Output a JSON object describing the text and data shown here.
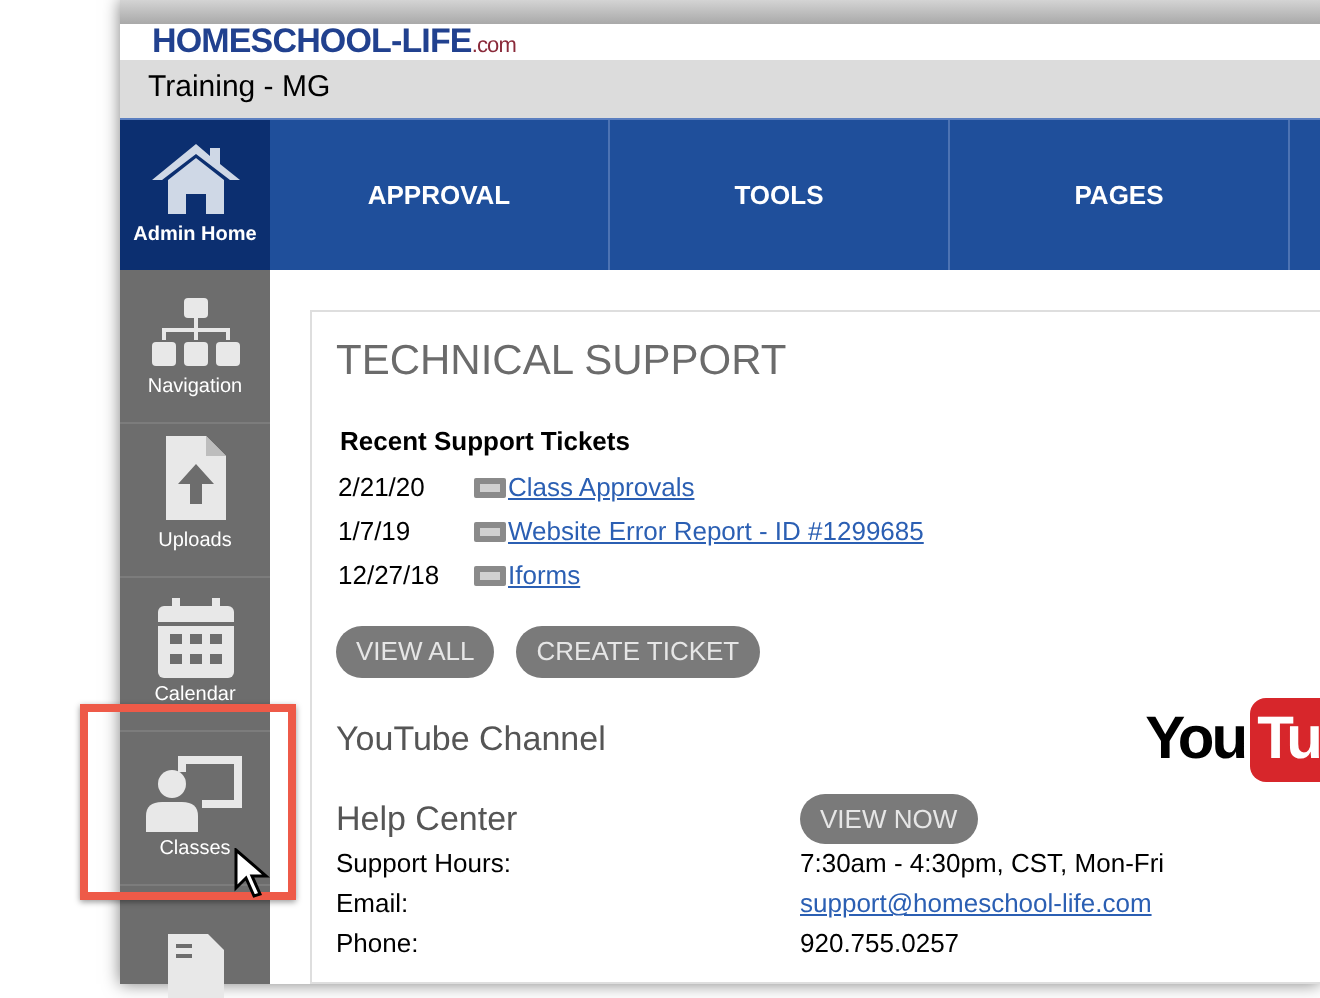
{
  "logo": {
    "name": "HOMESCHOOL-LIFE",
    "suffix": ".com"
  },
  "account": {
    "title": "Training - MG"
  },
  "nav_tabs": [
    {
      "label": "Admin Home",
      "selected": true
    },
    {
      "label": "APPROVAL",
      "selected": false
    },
    {
      "label": "TOOLS",
      "selected": false
    },
    {
      "label": "PAGES",
      "selected": false
    }
  ],
  "sidebar": {
    "items": [
      {
        "label": "Navigation",
        "highlighted": false
      },
      {
        "label": "Uploads",
        "highlighted": false
      },
      {
        "label": "Calendar",
        "highlighted": false
      },
      {
        "label": "Classes",
        "highlighted": true
      },
      {
        "highlighted": false
      }
    ]
  },
  "support": {
    "title": "TECHNICAL SUPPORT",
    "tickets_heading": "Recent Support Tickets",
    "tickets": [
      {
        "date": "2/21/20",
        "title": "Class Approvals"
      },
      {
        "date": "1/7/19",
        "title": "Website Error Report - ID #1299685"
      },
      {
        "date": "12/27/18",
        "title": "Iforms"
      }
    ],
    "buttons": [
      "VIEW ALL",
      "CREATE TICKET"
    ],
    "youtube": {
      "heading": "YouTube Channel",
      "logo_left": "You",
      "logo_right": "Tu"
    },
    "help": {
      "heading": "Help Center",
      "button": "VIEW NOW",
      "rows": [
        {
          "label": "Support Hours:",
          "value": "7:30am - 4:30pm, CST, Mon-Fri",
          "kind": "text"
        },
        {
          "label": "Email:",
          "value": "support@homeschool-life.com",
          "kind": "link"
        },
        {
          "label": "Phone:",
          "value": "920.755.0257",
          "kind": "text"
        }
      ]
    }
  }
}
